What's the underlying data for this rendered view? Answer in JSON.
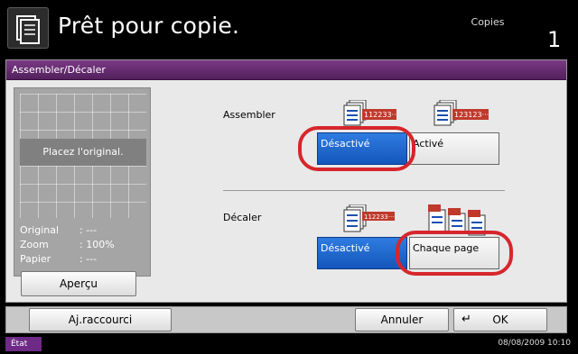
{
  "header": {
    "title": "Prêt pour copie.",
    "copies_label": "Copies",
    "copies_count": "1",
    "icon": "copier-icon"
  },
  "panel": {
    "title": "Assembler/Décaler"
  },
  "preview": {
    "message": "Placez l'original.",
    "rows": [
      {
        "key": "Original",
        "value": ": ---"
      },
      {
        "key": "Zoom",
        "value": ": 100%"
      },
      {
        "key": "Papier",
        "value": ": ---"
      }
    ],
    "apercu_label": "Aperçu"
  },
  "assembler": {
    "label": "Assembler",
    "off_label": "Désactivé",
    "on_label": "Activé",
    "selected": "off",
    "icon_off": "uncollated-stack-icon",
    "icon_on": "collated-stack-icon"
  },
  "decaler": {
    "label": "Décaler",
    "off_label": "Désactivé",
    "on_label": "Chaque page",
    "selected": "off",
    "icon_off": "no-offset-stack-icon",
    "icon_on": "offset-stack-icon"
  },
  "bottom": {
    "raccourci_label": "Aj.raccourci",
    "annuler_label": "Annuler",
    "ok_label": "OK",
    "enter_symbol": "↵"
  },
  "status": {
    "etat_label": "État",
    "datetime": "08/08/2009    10:10"
  },
  "colors": {
    "accent_purple": "#6e2a86",
    "selected_blue": "#1f66cf",
    "highlight_red": "#d6262c"
  }
}
